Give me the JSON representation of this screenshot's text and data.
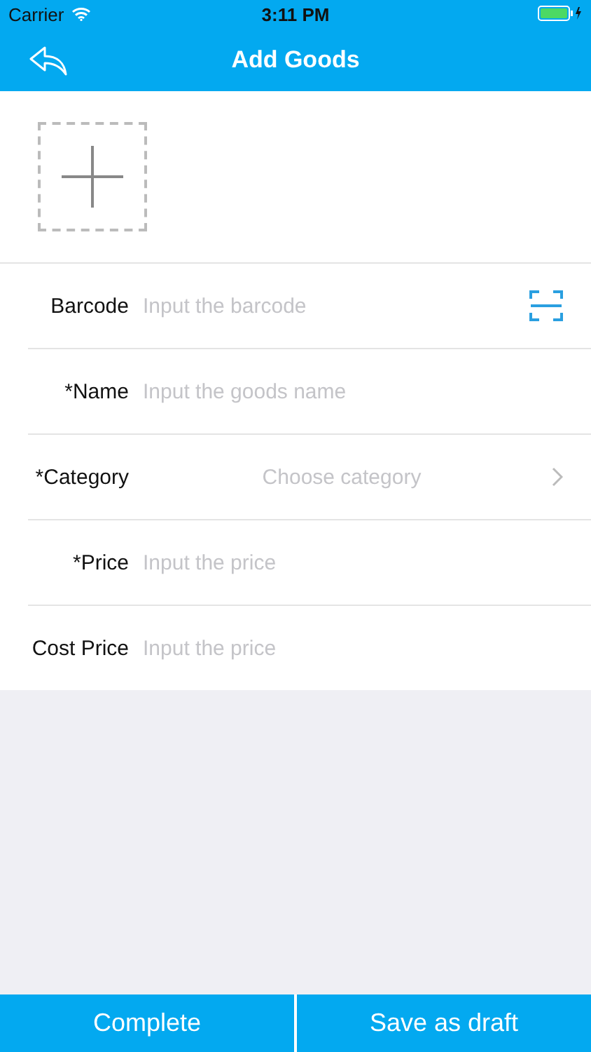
{
  "status_bar": {
    "carrier": "Carrier",
    "time": "3:11 PM"
  },
  "nav_bar": {
    "title": "Add Goods"
  },
  "fields": [
    {
      "kind": "scan",
      "label": "Barcode",
      "placeholder": "Input the barcode"
    },
    {
      "kind": "text",
      "label": "*Name",
      "placeholder": "Input the goods name"
    },
    {
      "kind": "select",
      "label": "*Category",
      "placeholder": "Choose category"
    },
    {
      "kind": "text",
      "label": "*Price",
      "placeholder": "Input the price"
    },
    {
      "kind": "text",
      "label": "Cost Price",
      "placeholder": "Input the price"
    }
  ],
  "buttons": [
    "Complete",
    "Save as draft"
  ]
}
